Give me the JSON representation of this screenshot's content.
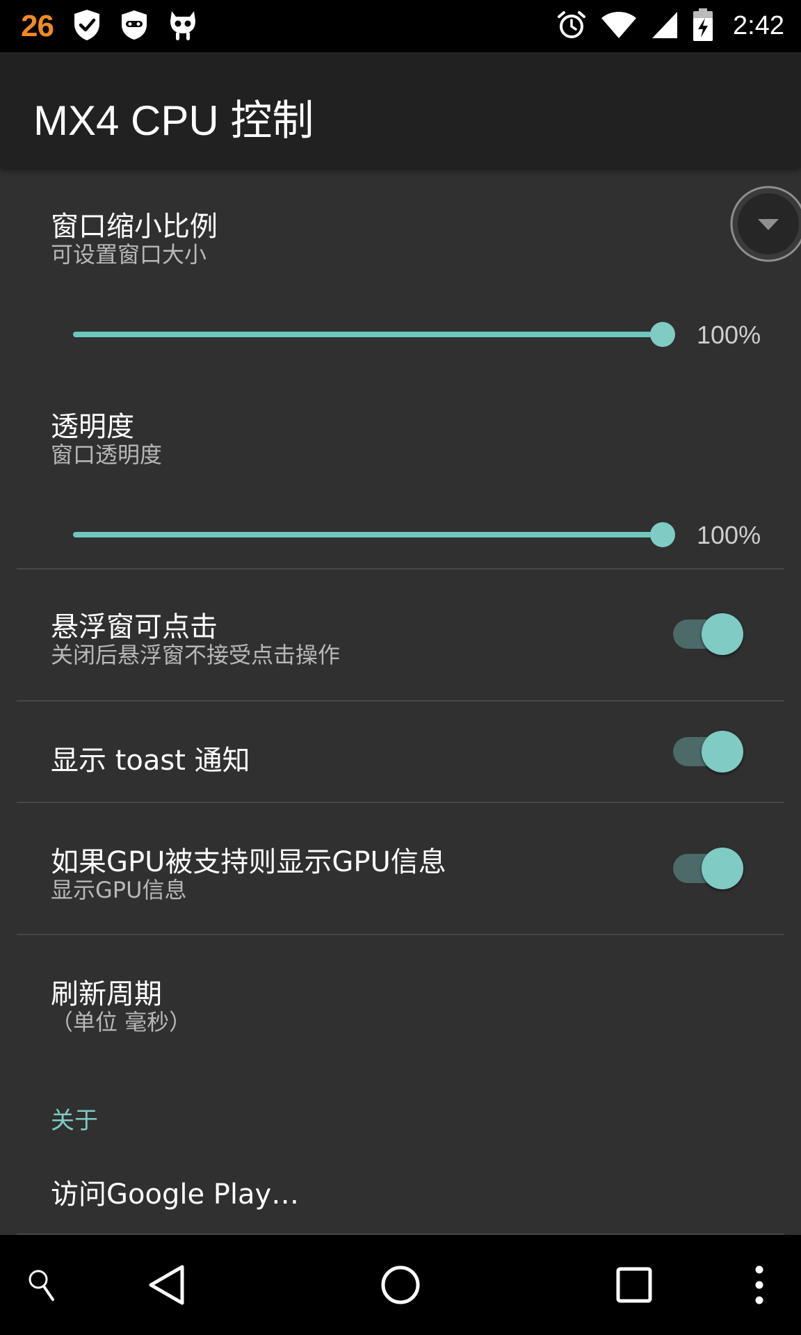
{
  "status_bar": {
    "notification_count": "26",
    "time": "2:42",
    "left_icons": [
      "shield-check-icon",
      "mask-shield-icon",
      "cyanogen-mascot-icon"
    ],
    "right_icons": [
      "alarm-icon",
      "wifi-icon",
      "cell-signal-icon",
      "battery-charging-icon"
    ]
  },
  "app_bar": {
    "title": "MX4 CPU 控制"
  },
  "prefs": {
    "window_scale": {
      "title": "窗口缩小比例",
      "summary": "可设置窗口大小",
      "value": "100%",
      "level": 1.0
    },
    "opacity": {
      "title": "透明度",
      "summary": "窗口透明度",
      "value": "100%",
      "level": 1.0
    },
    "clickable": {
      "title": "悬浮窗可点击",
      "summary": "关闭后悬浮窗不接受点击操作",
      "checked": true
    },
    "toast": {
      "title": "显示 toast 通知",
      "checked": true
    },
    "gpu": {
      "title": "如果GPU被支持则显示GPU信息",
      "summary": "显示GPU信息",
      "checked": true
    },
    "refresh": {
      "title": "刷新周期",
      "summary": "（单位 毫秒）"
    }
  },
  "about": {
    "header": "关于",
    "google_play": "访问Google Play…"
  },
  "colors": {
    "accent": "#80cbc4",
    "background": "#303030",
    "app_bar": "#212121",
    "status_orange": "#f08a24"
  },
  "nav_bar": {
    "icons": [
      "search-icon",
      "back-icon",
      "home-icon",
      "recents-icon",
      "overflow-menu-icon"
    ]
  }
}
